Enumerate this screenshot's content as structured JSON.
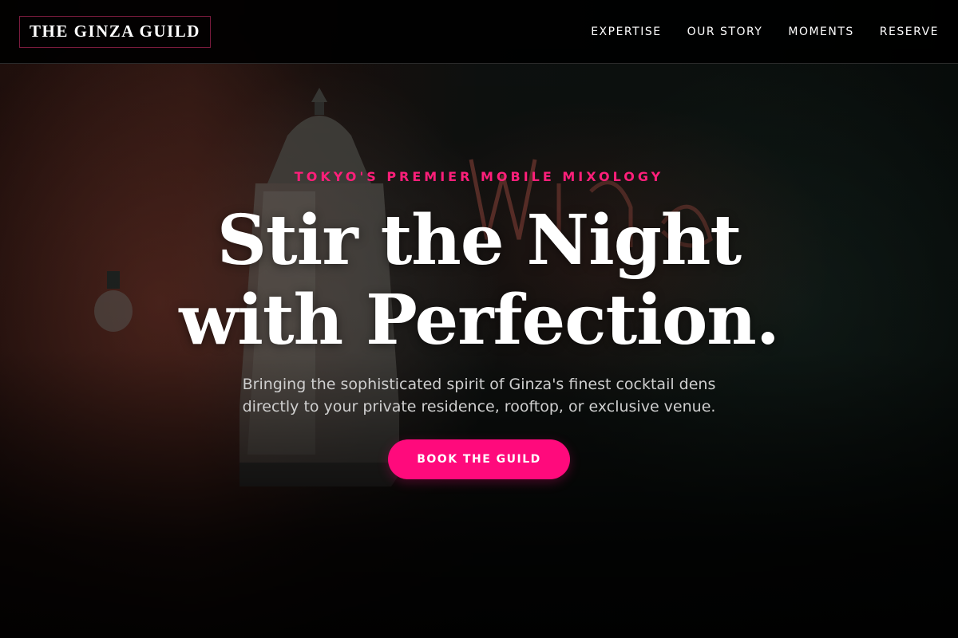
{
  "brand": {
    "logo_text": "THE GINZA GUILD"
  },
  "nav": {
    "items": [
      {
        "label": "EXPERTISE"
      },
      {
        "label": "OUR STORY"
      },
      {
        "label": "MOMENTS"
      },
      {
        "label": "RESERVE"
      }
    ]
  },
  "hero": {
    "eyebrow": "TOKYO'S PREMIER MOBILE MIXOLOGY",
    "headline_line1": "Stir the Night",
    "headline_line2": "with Perfection.",
    "subtext_line1": "Bringing the sophisticated spirit of Ginza's finest cocktail dens",
    "subtext_line2": "directly to your private residence, rooftop, or exclusive venue.",
    "cta_label": "BOOK THE GUILD"
  },
  "colors": {
    "accent": "#ff0a7c",
    "eyebrow": "#ff1f7a",
    "logo_border": "#7a1b3d",
    "nav_background": "#000000"
  }
}
